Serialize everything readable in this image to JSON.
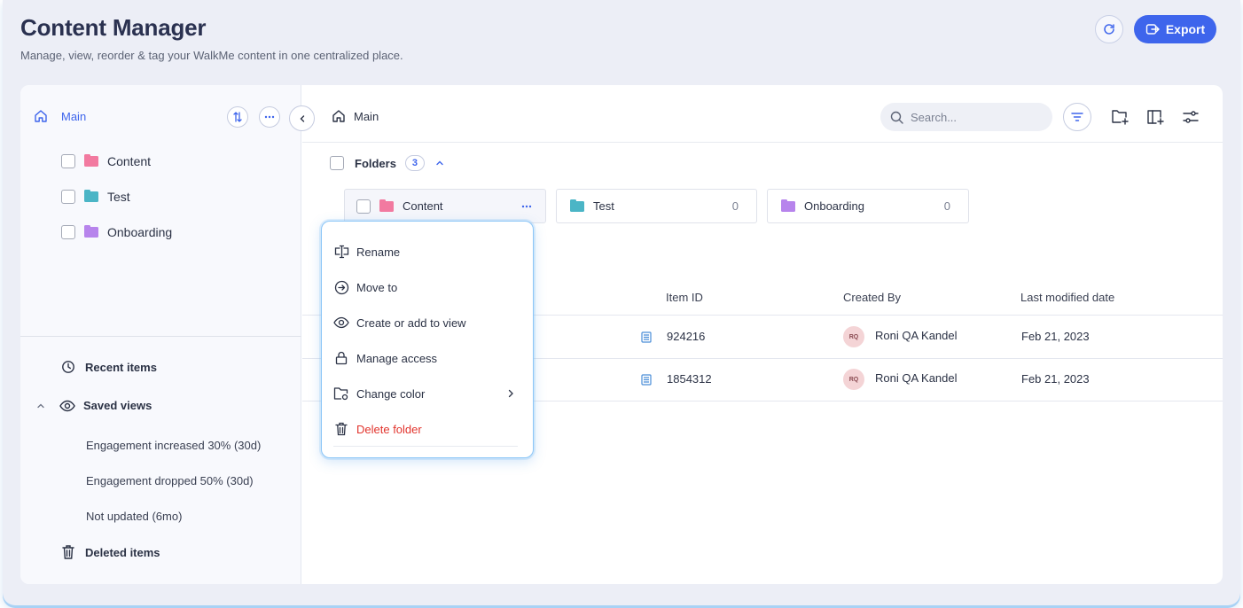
{
  "header": {
    "title": "Content Manager",
    "subtitle": "Manage, view, reorder & tag your WalkMe content in one centralized place.",
    "export_label": "Export"
  },
  "sidebar": {
    "root_label": "Main",
    "folders": [
      {
        "label": "Content",
        "color": "#f27aa0"
      },
      {
        "label": "Test",
        "color": "#4bb5c6"
      },
      {
        "label": "Onboarding",
        "color": "#b784ec"
      }
    ],
    "recent_label": "Recent items",
    "saved_views_label": "Saved views",
    "saved_views": [
      "Engagement increased 30% (30d)",
      "Engagement dropped 50% (30d)",
      "Not updated (6mo)"
    ],
    "deleted_label": "Deleted items"
  },
  "main": {
    "breadcrumb": "Main",
    "search_placeholder": "Search...",
    "folders_title": "Folders",
    "folders_count": "3",
    "folder_cards": [
      {
        "name": "Content",
        "count": "",
        "color": "#f27aa0"
      },
      {
        "name": "Test",
        "count": "0",
        "color": "#4bb5c6"
      },
      {
        "name": "Onboarding",
        "count": "0",
        "color": "#b784ec"
      }
    ],
    "columns": {
      "item_id": "Item ID",
      "created_by": "Created By",
      "modified": "Last modified date"
    },
    "rows": [
      {
        "item_id": "924216",
        "avatar": "RQ",
        "created_by": "Roni QA Kandel",
        "modified": "Feb 21, 2023"
      },
      {
        "item_id": "1854312",
        "avatar": "RQ",
        "created_by": "Roni QA Kandel",
        "modified": "Feb 21, 2023"
      }
    ]
  },
  "context_menu": {
    "items": [
      {
        "label": "Rename",
        "icon": "rename-icon"
      },
      {
        "label": "Move to",
        "icon": "move-icon"
      },
      {
        "label": "Create or add to view",
        "icon": "eye-icon"
      },
      {
        "label": "Manage access",
        "icon": "lock-icon"
      },
      {
        "label": "Change color",
        "icon": "color-folder-icon"
      },
      {
        "label": "Delete folder",
        "icon": "trash-icon"
      }
    ]
  },
  "colors": {
    "accent": "#3e65ec",
    "danger": "#e2342d",
    "content_folder": "#f27aa0",
    "test_folder": "#4bb5c6",
    "onboarding_folder": "#b784ec"
  }
}
